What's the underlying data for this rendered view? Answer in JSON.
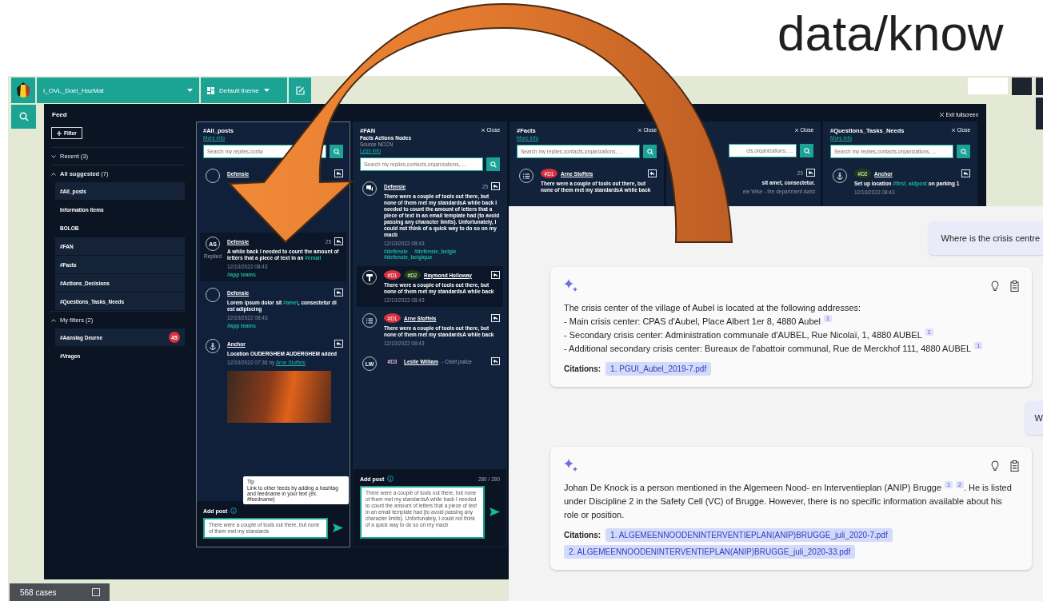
{
  "slide_title": "data/know",
  "map_app": {
    "toolbar": {
      "workspace": "I_OVL_Doel_HazMat",
      "theme": "Default theme"
    },
    "cases": {
      "label": "568 cases",
      "checked": false
    },
    "feed": {
      "title": "Feed",
      "exit_label": "Exit fullscreen",
      "filter_label": "Filter",
      "sidebar": [
        {
          "label": "Recent (3)",
          "expanded": false
        },
        {
          "label": "**All suggested** (7)",
          "expanded": true,
          "items": [
            {
              "label": "#All_posts",
              "highlighted": true
            },
            {
              "label": "Information items",
              "highlighted": false
            },
            {
              "label": "BOLOB",
              "highlighted": false
            },
            {
              "label": "#FAN",
              "highlighted": true
            },
            {
              "label": "#Facts",
              "highlighted": true
            },
            {
              "label": "#Actions_Decisions",
              "highlighted": true
            },
            {
              "label": "#Questions_Tasks_Needs",
              "highlighted": true
            }
          ]
        },
        {
          "label": "My filters (2)",
          "expanded": true,
          "items": [
            {
              "label": "#Aanslag Deurne",
              "highlighted": true,
              "badge": "45"
            },
            {
              "label": "#Vragen",
              "highlighted": false
            }
          ]
        }
      ],
      "columns": [
        {
          "kind": "full",
          "title": "#All_posts",
          "info_link": "More info",
          "search_placeholder": "Search my replies,conta",
          "selected": true,
          "posts": [
            {
              "avatar": {
                "kind": "empty"
              },
              "author": "Defensie",
              "highlighted": false
            },
            {
              "avatar": {
                "kind": "initials",
                "text": "AS"
              },
              "status": "Replied",
              "author": "Defensie",
              "count": "25",
              "highlighted": true,
              "body": [
                {
                  "kind": "text",
                  "text": "A while back I needed to count the amount of letters that a piece of text in an "
                },
                {
                  "kind": "hashtag",
                  "text": "#email"
                }
              ],
              "meta": "12/10/2022  08:43",
              "hashtags": [
                "#app teams"
              ]
            },
            {
              "avatar": {
                "kind": "empty"
              },
              "author": "Defensie",
              "highlighted": false,
              "body": [
                {
                  "kind": "text",
                  "text": "Lorem ipsum dolor sit "
                },
                {
                  "kind": "hashtag",
                  "text": "#amet"
                },
                {
                  "kind": "text",
                  "text": ", consectetur di est adipiscing"
                }
              ],
              "meta": "12/10/2022  08:43",
              "hashtags": [
                "#app teams"
              ]
            },
            {
              "avatar": {
                "kind": "anchor"
              },
              "author": "Anchor",
              "highlighted": false,
              "body": [
                {
                  "kind": "text",
                  "text": "Location OUDERGHEM AUDERGHEM added"
                }
              ],
              "meta": "12/10/2022 07:36 by",
              "by_link": "Arne Stoffels",
              "image": true
            }
          ],
          "add_post": {
            "label": "Add post",
            "value": "There were a couple of tools out there, but none of them met my standards",
            "tip": {
              "title": "Tip",
              "text": "Link to other feeds by adding a hashtag and feedname in your text (ex. #feedname)"
            }
          }
        },
        {
          "kind": "full",
          "title": "#FAN",
          "subtitle": "Facts Actions Nodes",
          "source": "Source NCCN",
          "info_link": "Less info",
          "close_label": "Close",
          "search_placeholder": "Search my replies,contacts,organizations, ...",
          "selected": false,
          "posts": [
            {
              "avatar": {
                "kind": "chat"
              },
              "author": "Defensie",
              "count": "25",
              "highlighted": false,
              "body": [
                {
                  "kind": "text",
                  "text": "There were a couple of tools out there, but none of them met my standardsA while back I needed to count the amount of letters that a piece of text in an email template had (to avoid passing any character limits). Unfortunately, I could not think of a quick way to do so on my macb"
                }
              ],
              "meta": "12/10/2022  08:43",
              "hashtags": [
                "#defensie",
                "#defensie_belgie",
                "#defensie_belgique"
              ]
            },
            {
              "avatar": {
                "kind": "hammer"
              },
              "tags": [
                {
                  "text": "#D1",
                  "color": "#d9303f"
                },
                {
                  "text": "#D2",
                  "color": "#1f3d12"
                }
              ],
              "author": "Raymond Holloway",
              "highlighted": true,
              "body": [
                {
                  "kind": "text",
                  "text": "There were a couple of tools out there, but none of them met my standardsA while back"
                }
              ],
              "meta": "12/10/2022  08:43"
            },
            {
              "avatar": {
                "kind": "list"
              },
              "tags": [
                {
                  "text": "#D1",
                  "color": "#d9303f"
                }
              ],
              "author": "Arne Stoffels",
              "highlighted": false,
              "body": [
                {
                  "kind": "text",
                  "text": "There were a couple of tools out there, but none of them met my standardsA while back"
                }
              ],
              "meta": "12/10/2022  08:43"
            },
            {
              "avatar": {
                "kind": "initials",
                "text": "LW"
              },
              "tags": [
                {
                  "text": "#D3",
                  "color": "#1a1d3a"
                }
              ],
              "author": "Leslie William",
              "role": "- Chief police",
              "highlighted": false
            }
          ],
          "add_post": {
            "label": "Add post",
            "counter": "280 / 280",
            "value": "There were a couple of tools out there, but none of them met my standardsA while back I needed to count the amount of letters that a piece of text in an email template had (to avoid passing any character limits). Unfortunately, I could not think of a quick way to do so on my macb"
          }
        },
        {
          "kind": "full",
          "title": "#Facts",
          "info_link": "More info",
          "close_label": "Close",
          "search_placeholder": "Search my replies,contacts,organizations, ...",
          "selected": false,
          "posts": [
            {
              "avatar": {
                "kind": "list"
              },
              "tags": [
                {
                  "text": "#D1",
                  "color": "#d9303f"
                }
              ],
              "author": "Arne Stoffels",
              "highlighted": false,
              "body": [
                {
                  "kind": "text",
                  "text": "There were a couple of tools out there, but none of them met my standardsA while back"
                }
              ]
            }
          ]
        },
        {
          "kind": "partial",
          "close_label": "Close",
          "search_placeholder": "cts,organizations, ...",
          "selected": false,
          "posts": [
            {
              "count": "25",
              "highlighted": false,
              "body": [
                {
                  "kind": "text",
                  "text": "sit amet, consectetur."
                }
              ],
              "meta": "ele Wise - fire department Aalst"
            }
          ]
        },
        {
          "kind": "full",
          "title": "#Questions_Tasks_Needs",
          "info_link": "More info",
          "close_label": "Close",
          "search_placeholder": "Search my replies,contacts,organizations, ...",
          "selected": false,
          "posts": [
            {
              "avatar": {
                "kind": "anchor"
              },
              "tags": [
                {
                  "text": "#D2",
                  "color": "#1f3d12"
                }
              ],
              "author": "Anchor",
              "highlighted": false,
              "body": [
                {
                  "kind": "text",
                  "text": "Set up location "
                },
                {
                  "kind": "hashtag",
                  "text": "#first_aidpost"
                },
                {
                  "kind": "text",
                  "text": " on parking 1"
                }
              ],
              "meta": "12/10/2022  08:43"
            }
          ]
        }
      ]
    }
  },
  "chat": {
    "messages": [
      {
        "kind": "user",
        "text": "Where is the crisis centre"
      },
      {
        "kind": "answer",
        "body": [
          {
            "kind": "text",
            "text": "The crisis center of the village of Aubel is located at the following addresses:\n- Main crisis center: CPAS d'Aubel, Place Albert 1er 8, 4880 Aubel"
          },
          {
            "kind": "ref",
            "text": "1"
          },
          {
            "kind": "text",
            "text": "\n- Secondary crisis center: Administration communale d'AUBEL, Rue Nicolaï, 1, 4880 AUBEL"
          },
          {
            "kind": "ref",
            "text": "1"
          },
          {
            "kind": "text",
            "text": "\n- Additional secondary crisis center: Bureaux de l'abattoir communal, Rue de Merckhof 111, 4880 AUBEL"
          },
          {
            "kind": "ref",
            "text": "1"
          }
        ],
        "citations_label": "Citations:",
        "citations": [
          "1. PGUI_Aubel_2019-7.pdf"
        ]
      },
      {
        "kind": "user",
        "text": "W"
      },
      {
        "kind": "answer",
        "body": [
          {
            "kind": "text",
            "text": "Johan De Knock is a person mentioned in the Algemeen Nood- en Interventieplan (ANIP) Brugge"
          },
          {
            "kind": "ref",
            "text": "1"
          },
          {
            "kind": "ref",
            "text": "2"
          },
          {
            "kind": "text",
            "text": ". He is listed under Discipline 2 in the Safety Cell (VC) of Brugge. However, there is no specific information available about his role or position."
          }
        ],
        "citations_label": "Citations:",
        "citations": [
          "1. ALGEMEENNOODENINTERVENTIEPLAN(ANIP)BRUGGE_juli_2020-7.pdf",
          "2. ALGEMEENNOODENINTERVENTIEPLAN(ANIP)BRUGGE_juli_2020-33.pdf"
        ]
      }
    ]
  }
}
